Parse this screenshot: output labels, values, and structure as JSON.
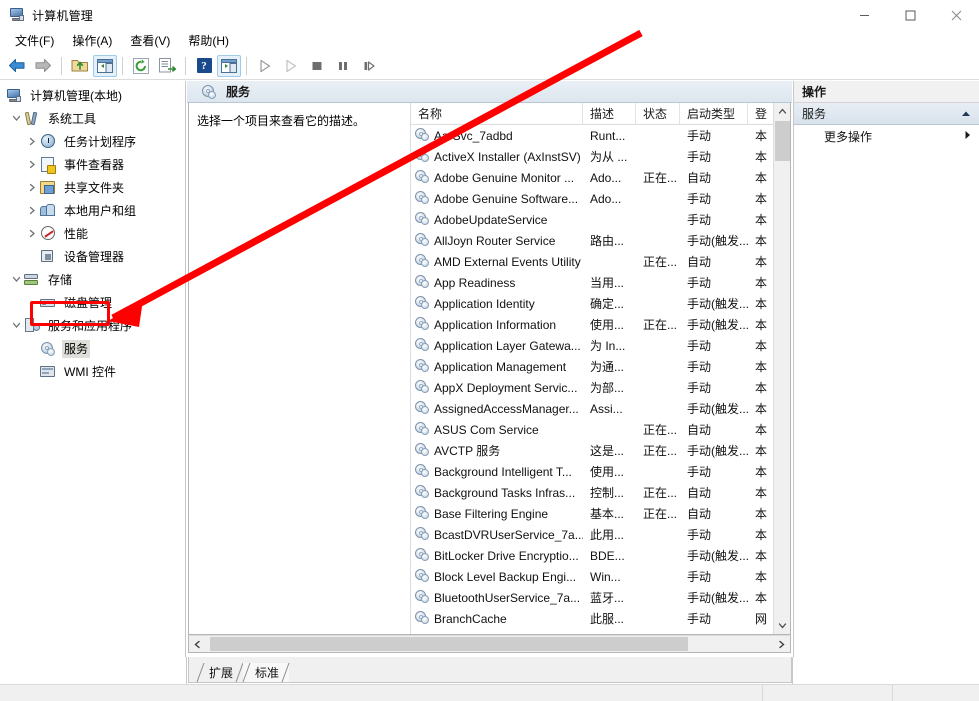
{
  "window": {
    "title": "计算机管理",
    "icon": "computer-management-icon",
    "minimize_label": "最小化",
    "maximize_label": "最大化",
    "close_label": "关闭"
  },
  "menubar": {
    "items": [
      {
        "label": "文件(F)",
        "name": "menu-file"
      },
      {
        "label": "操作(A)",
        "name": "menu-action"
      },
      {
        "label": "查看(V)",
        "name": "menu-view"
      },
      {
        "label": "帮助(H)",
        "name": "menu-help"
      }
    ]
  },
  "toolbar": {
    "buttons": [
      {
        "name": "back-arrow-icon",
        "title": "后退"
      },
      {
        "name": "forward-arrow-icon",
        "title": "前进"
      },
      {
        "name": "up-folder-icon",
        "title": "向上一级"
      },
      {
        "name": "show-hide-tree-icon",
        "title": "显示/隐藏控制台树"
      },
      {
        "name": "refresh-icon",
        "title": "刷新"
      },
      {
        "name": "export-list-icon",
        "title": "导出列表"
      },
      {
        "name": "help-icon",
        "title": "帮助"
      },
      {
        "name": "properties-pane-icon",
        "title": "显示/隐藏操作窗格"
      },
      {
        "name": "start-service-icon",
        "title": "启动服务"
      },
      {
        "name": "resume-service-icon",
        "title": "继续服务"
      },
      {
        "name": "stop-service-icon",
        "title": "停止服务"
      },
      {
        "name": "pause-service-icon",
        "title": "暂停服务"
      },
      {
        "name": "restart-service-icon",
        "title": "重启动服务"
      }
    ]
  },
  "tree": {
    "nodes": [
      {
        "label": "计算机管理(本地)",
        "indent": 0,
        "twisty": "none",
        "icon": "computer-icon",
        "selected": false
      },
      {
        "label": "系统工具",
        "indent": 1,
        "twisty": "expanded",
        "icon": "system-tools-icon",
        "selected": false
      },
      {
        "label": "任务计划程序",
        "indent": 2,
        "twisty": "collapsed",
        "icon": "task-scheduler-icon",
        "selected": false
      },
      {
        "label": "事件查看器",
        "indent": 2,
        "twisty": "collapsed",
        "icon": "event-viewer-icon",
        "selected": false
      },
      {
        "label": "共享文件夹",
        "indent": 2,
        "twisty": "collapsed",
        "icon": "shared-folders-icon",
        "selected": false
      },
      {
        "label": "本地用户和组",
        "indent": 2,
        "twisty": "collapsed",
        "icon": "local-users-groups-icon",
        "selected": false
      },
      {
        "label": "性能",
        "indent": 2,
        "twisty": "collapsed",
        "icon": "performance-icon",
        "selected": false
      },
      {
        "label": "设备管理器",
        "indent": 2,
        "twisty": "none",
        "icon": "device-manager-icon",
        "selected": false
      },
      {
        "label": "存储",
        "indent": 1,
        "twisty": "expanded",
        "icon": "storage-icon",
        "selected": false
      },
      {
        "label": "磁盘管理",
        "indent": 2,
        "twisty": "none",
        "icon": "disk-management-icon",
        "selected": false
      },
      {
        "label": "服务和应用程序",
        "indent": 1,
        "twisty": "expanded",
        "icon": "services-applications-icon",
        "selected": false
      },
      {
        "label": "服务",
        "indent": 2,
        "twisty": "none",
        "icon": "services-gear-icon",
        "selected": true
      },
      {
        "label": "WMI 控件",
        "indent": 2,
        "twisty": "none",
        "icon": "wmi-control-icon",
        "selected": false
      }
    ]
  },
  "main": {
    "header_title": "服务",
    "header_icon": "services-gear-icon",
    "description_prompt": "选择一个项目来查看它的描述。",
    "columns": [
      {
        "key": "name",
        "label": "名称"
      },
      {
        "key": "desc",
        "label": "描述"
      },
      {
        "key": "state",
        "label": "状态"
      },
      {
        "key": "start",
        "label": "启动类型"
      },
      {
        "key": "logon",
        "label": "登"
      }
    ],
    "rows": [
      {
        "name": "AarSvc_7adbd",
        "desc": "Runt...",
        "state": "",
        "start": "手动",
        "logon": "本"
      },
      {
        "name": "ActiveX Installer (AxInstSV)",
        "desc": "为从 ...",
        "state": "",
        "start": "手动",
        "logon": "本"
      },
      {
        "name": "Adobe Genuine Monitor ...",
        "desc": "Ado...",
        "state": "正在...",
        "start": "自动",
        "logon": "本"
      },
      {
        "name": "Adobe Genuine Software...",
        "desc": "Ado...",
        "state": "",
        "start": "手动",
        "logon": "本"
      },
      {
        "name": "AdobeUpdateService",
        "desc": "",
        "state": "",
        "start": "手动",
        "logon": "本"
      },
      {
        "name": "AllJoyn Router Service",
        "desc": "路由...",
        "state": "",
        "start": "手动(触发...",
        "logon": "本"
      },
      {
        "name": "AMD External Events Utility",
        "desc": "",
        "state": "正在...",
        "start": "自动",
        "logon": "本"
      },
      {
        "name": "App Readiness",
        "desc": "当用...",
        "state": "",
        "start": "手动",
        "logon": "本"
      },
      {
        "name": "Application Identity",
        "desc": "确定...",
        "state": "",
        "start": "手动(触发...",
        "logon": "本"
      },
      {
        "name": "Application Information",
        "desc": "使用...",
        "state": "正在...",
        "start": "手动(触发...",
        "logon": "本"
      },
      {
        "name": "Application Layer Gatewa...",
        "desc": "为 In...",
        "state": "",
        "start": "手动",
        "logon": "本"
      },
      {
        "name": "Application Management",
        "desc": "为通...",
        "state": "",
        "start": "手动",
        "logon": "本"
      },
      {
        "name": "AppX Deployment Servic...",
        "desc": "为部...",
        "state": "",
        "start": "手动",
        "logon": "本"
      },
      {
        "name": "AssignedAccessManager...",
        "desc": "Assi...",
        "state": "",
        "start": "手动(触发...",
        "logon": "本"
      },
      {
        "name": "ASUS Com Service",
        "desc": "",
        "state": "正在...",
        "start": "自动",
        "logon": "本"
      },
      {
        "name": "AVCTP 服务",
        "desc": "这是...",
        "state": "正在...",
        "start": "手动(触发...",
        "logon": "本"
      },
      {
        "name": "Background Intelligent T...",
        "desc": "使用...",
        "state": "",
        "start": "手动",
        "logon": "本"
      },
      {
        "name": "Background Tasks Infras...",
        "desc": "控制...",
        "state": "正在...",
        "start": "自动",
        "logon": "本"
      },
      {
        "name": "Base Filtering Engine",
        "desc": "基本...",
        "state": "正在...",
        "start": "自动",
        "logon": "本"
      },
      {
        "name": "BcastDVRUserService_7a...",
        "desc": "此用...",
        "state": "",
        "start": "手动",
        "logon": "本"
      },
      {
        "name": "BitLocker Drive Encryptio...",
        "desc": "BDE...",
        "state": "",
        "start": "手动(触发...",
        "logon": "本"
      },
      {
        "name": "Block Level Backup Engi...",
        "desc": "Win...",
        "state": "",
        "start": "手动",
        "logon": "本"
      },
      {
        "name": "BluetoothUserService_7a...",
        "desc": "蓝牙...",
        "state": "",
        "start": "手动(触发...",
        "logon": "本"
      },
      {
        "name": "BranchCache",
        "desc": "此服...",
        "state": "",
        "start": "手动",
        "logon": "网"
      }
    ],
    "tabs": [
      {
        "label": "扩展",
        "active": false
      },
      {
        "label": "标准",
        "active": true
      }
    ],
    "hscroll_left_icon": "scroll-left-icon",
    "hscroll_right_icon": "scroll-right-icon",
    "vscroll_up_icon": "scroll-up-icon",
    "vscroll_down_icon": "scroll-down-icon"
  },
  "actions": {
    "header": "操作",
    "group_label": "服务",
    "group_collapse_icon": "chevron-up-icon",
    "items": [
      {
        "label": "更多操作",
        "chevron": "chevron-right-icon"
      }
    ]
  },
  "annotations": {
    "arrow_color": "#ff0000",
    "highlight_color": "#ff0000",
    "highlight_target": "服务"
  }
}
